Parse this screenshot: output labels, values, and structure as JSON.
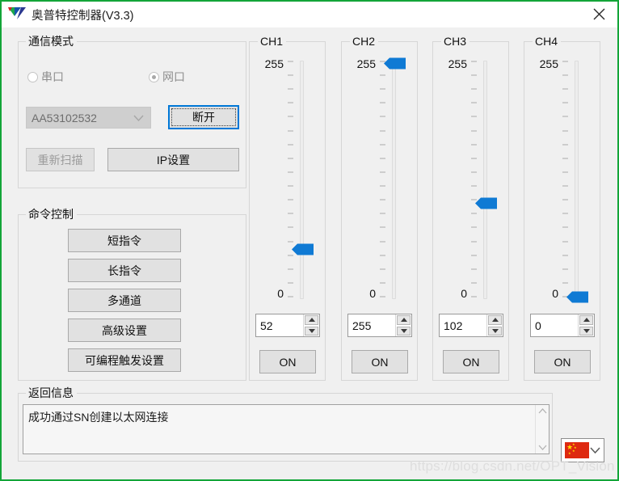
{
  "window": {
    "title": "奥普特控制器(V3.3)",
    "logo_icon": "opt-triangle-logo-icon",
    "close_icon": "close-icon",
    "accent_color": "#0078d7",
    "border_color": "#13a538",
    "thumb_color": "#0f7ad4"
  },
  "comm_panel": {
    "title": "通信模式",
    "radios": [
      {
        "label": "串口",
        "checked": false,
        "name": "radio-serial-port"
      },
      {
        "label": "网口",
        "checked": true,
        "name": "radio-network-port"
      }
    ],
    "device_combo": {
      "value": "AA53102532",
      "disabled": true,
      "chevron_icon": "chevron-down-icon"
    },
    "disconnect_button": {
      "label": "断开",
      "focused": true
    },
    "rescan_button": {
      "label": "重新扫描",
      "disabled": true
    },
    "ip_settings_button": {
      "label": "IP设置"
    }
  },
  "command_panel": {
    "title": "命令控制",
    "buttons": [
      {
        "label": "短指令",
        "name": "short-command-button"
      },
      {
        "label": "长指令",
        "name": "long-command-button"
      },
      {
        "label": "多通道",
        "name": "multi-channel-button"
      },
      {
        "label": "高级设置",
        "name": "advanced-settings-button"
      },
      {
        "label": "可编程触发设置",
        "name": "programmable-trigger-settings-button"
      }
    ]
  },
  "channels": {
    "scale_max_label": "255",
    "scale_min_label": "0",
    "min": 0,
    "max": 255,
    "tick_count": 18,
    "on_label": "ON",
    "spin_up_icon": "triangle-up-icon",
    "spin_down_icon": "triangle-down-icon",
    "items": [
      {
        "title": "CH1",
        "value": 52,
        "value_text": "52",
        "on_label": "ON"
      },
      {
        "title": "CH2",
        "value": 255,
        "value_text": "255",
        "on_label": "ON"
      },
      {
        "title": "CH3",
        "value": 102,
        "value_text": "102",
        "on_label": "ON"
      },
      {
        "title": "CH4",
        "value": 0,
        "value_text": "0",
        "on_label": "ON"
      }
    ]
  },
  "return_panel": {
    "title": "返回信息",
    "message": "成功通过SN创建以太网连接",
    "scroll_up_icon": "chevron-up-icon",
    "scroll_down_icon": "chevron-down-icon"
  },
  "language_combo": {
    "flag_icon": "china-flag-icon",
    "chevron_icon": "chevron-down-icon"
  },
  "watermark": {
    "text": "https://blog.csdn.net/OPT_Vision"
  }
}
